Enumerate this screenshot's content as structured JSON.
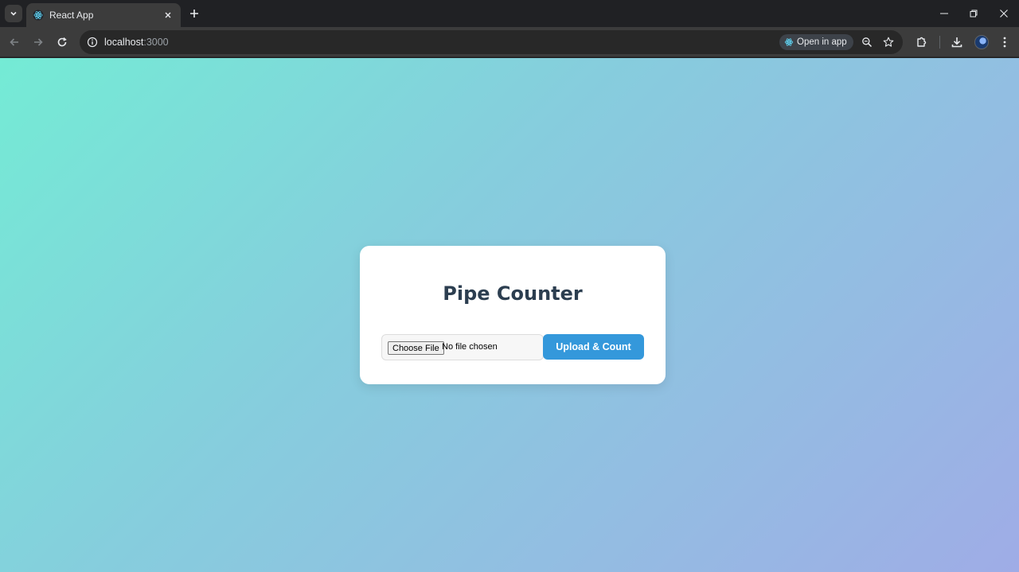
{
  "browser": {
    "tab_title": "React App",
    "url_host": "localhost",
    "url_port": ":3000",
    "open_in_app_label": "Open in app"
  },
  "icons": {
    "tab_search": "chevron-down-icon",
    "favicon": "react-icon",
    "close": "close-icon",
    "new_tab": "plus-icon",
    "back": "arrow-left-icon",
    "forward": "arrow-right-icon",
    "reload": "reload-icon",
    "site_info": "info-icon",
    "zoom": "zoom-icon",
    "bookmark": "star-icon",
    "extensions": "puzzle-icon",
    "downloads": "download-icon",
    "menu": "kebab-icon"
  },
  "app": {
    "title": "Pipe Counter",
    "file_input": {
      "button_label": "Choose File",
      "status": "No file chosen"
    },
    "upload_button_label": "Upload & Count"
  },
  "colors": {
    "primary_button": "#3498db",
    "title_text": "#2c3e50",
    "gradient_start": "#74ebd5",
    "gradient_end": "#9face6"
  }
}
